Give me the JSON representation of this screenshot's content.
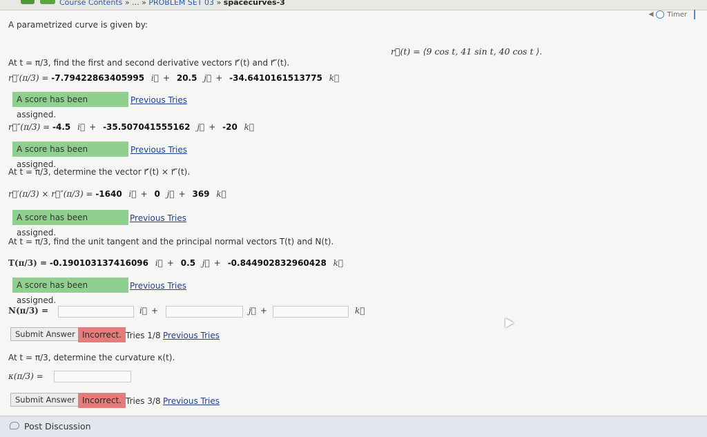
{
  "breadcrumb": {
    "course_link": "Course Contents",
    "sep1": "»",
    "ellipsis": "...",
    "sep2": "»",
    "problem_set": "PROBLEM SET 03",
    "sep3": "»",
    "current": "spacecurves-3"
  },
  "timer": {
    "label": "Timer"
  },
  "intro": "A parametrized curve is given by:",
  "curve_formula": "r⃗(t) = ⟨9 cos t,  41 sin t,  40 cos t ⟩.",
  "q1": {
    "prompt": "At t = π/3, find the first and second derivative vectors r⃗′(t) and r⃗″(t).",
    "r1_label": "r⃗′(π/3) =",
    "r1": [
      "-7.79422863405995",
      "20.5",
      "-34.6410161513775"
    ],
    "r1_status": "A score has been assigned.",
    "r2_label": "r⃗″(π/3) =",
    "r2": [
      "-4.5",
      "-35.507041555162",
      "-20"
    ],
    "r2_status": "A score has been assigned."
  },
  "q2": {
    "prompt": "At t = π/3, determine the vector r⃗′(t) × r⃗″(t).",
    "label": "r⃗′(π/3) × r⃗″(π/3) =",
    "values": [
      "-1640",
      "0",
      "369"
    ],
    "status": "A score has been assigned."
  },
  "q3": {
    "prompt": "At t = π/3, find the unit tangent and the principal normal vectors T(t) and N(t).",
    "T_label": "T(π/3) =",
    "T": [
      "-0.190103137416096",
      "0.5",
      "-0.844902832960428"
    ],
    "T_status": "A score has been assigned.",
    "N_label": "N(π/3) =",
    "N_inputs": [
      "",
      "",
      ""
    ],
    "submit": "Submit Answer",
    "status": "Incorrect.",
    "tries": "Tries 1/8"
  },
  "q4": {
    "prompt": "At t = π/3, determine the curvature κ(t).",
    "label": "κ(π/3) =",
    "input": "",
    "submit": "Submit Answer",
    "status": "Incorrect.",
    "tries": "Tries 3/8"
  },
  "units": {
    "i": "i⃗",
    "j": "j⃗",
    "k": "k⃗",
    "plus": "+"
  },
  "previous_tries": "Previous Tries",
  "footer": {
    "label": "Post Discussion"
  },
  "colors": {
    "status_green": "#8fd08f",
    "status_red": "#e57b7b",
    "link": "#1f3f8f"
  }
}
